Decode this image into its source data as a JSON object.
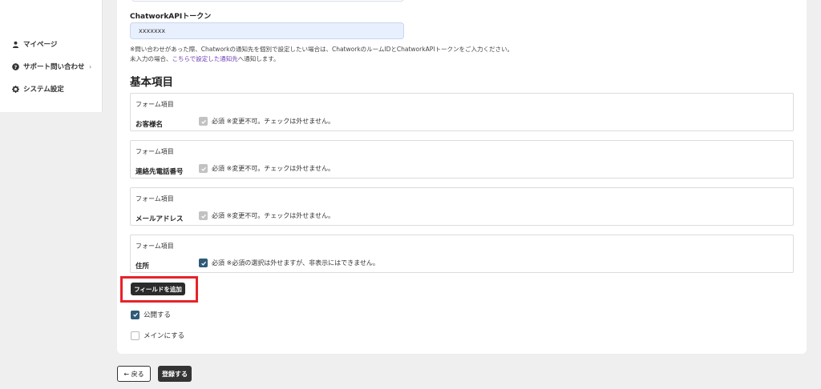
{
  "sidebar": {
    "items": [
      {
        "label": "マイページ",
        "icon": "user-icon"
      },
      {
        "label": "サポート問い合わせ",
        "icon": "help-circle-icon",
        "chevron": "›"
      },
      {
        "label": "システム設定",
        "icon": "gear-icon"
      }
    ]
  },
  "chatwork": {
    "label": "ChatworkAPIトークン",
    "value": "xxxxxxx",
    "note1": "※問い合わせがあった際、Chatworkの通知先を個別で設定したい場合は、ChatworkのルームIDとChatworkAPIトークンをご入力ください。",
    "note2_prefix": "未入力の場合、",
    "note2_link": "こちらで設定した通知先",
    "note2_suffix": "へ通知します。"
  },
  "basic": {
    "title": "基本項目",
    "fields": [
      {
        "sub": "フォーム項目",
        "name": "お客様名",
        "required": "必須",
        "note": "※変更不可。チェックは外せません。"
      },
      {
        "sub": "フォーム項目",
        "name": "連絡先電話番号",
        "required": "必須",
        "note": "※変更不可。チェックは外せません。"
      },
      {
        "sub": "フォーム項目",
        "name": "メールアドレス",
        "required": "必須",
        "note": "※変更不可。チェックは外せません。"
      },
      {
        "sub": "フォーム項目",
        "name": "住所",
        "required": "必須",
        "note": "※必須の選択は外せますが、非表示にはできません。"
      }
    ]
  },
  "actions": {
    "add_field": "フィールドを追加",
    "publish": "公開する",
    "make_main": "メインにする",
    "back": "← 戻る",
    "submit": "登録する"
  },
  "colors": {
    "checkbox_active": "#2f5a78",
    "checkbox_disabled": "#c2c2c2",
    "highlight": "#e8222a",
    "input_bg": "#e8f0fe"
  }
}
